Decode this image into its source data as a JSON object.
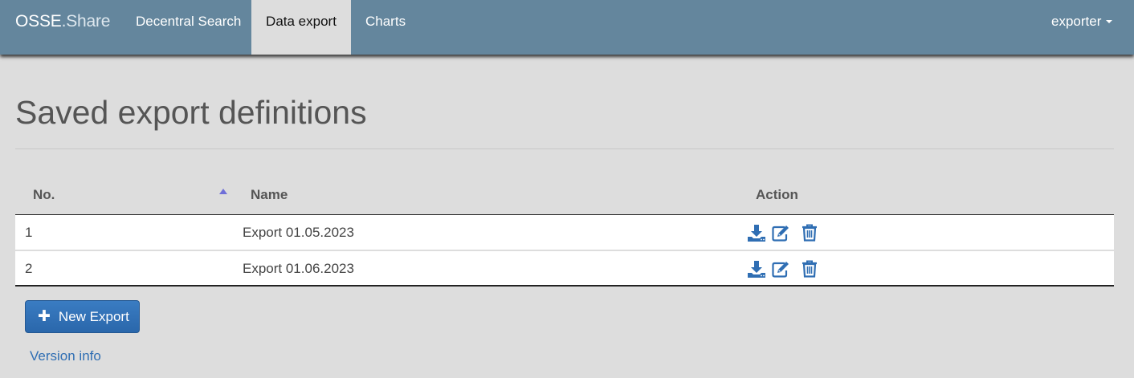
{
  "navbar": {
    "brand_part1": "OSSE",
    "brand_part2": ".Share",
    "links": {
      "search": "Decentral Search",
      "export": "Data export",
      "charts": "Charts"
    },
    "active": "Data export",
    "user": "exporter",
    "bg_color": "#64869d"
  },
  "page": {
    "title": "Saved export definitions"
  },
  "table": {
    "headers": {
      "no": "No.",
      "name": "Name",
      "action": "Action"
    },
    "sort": {
      "column": "No.",
      "direction": "ascending",
      "icon": "sort-asc-icon"
    },
    "rows": [
      {
        "no": "1",
        "name": "Export 01.05.2023",
        "actions": [
          "download-icon",
          "edit-icon",
          "delete-icon"
        ]
      },
      {
        "no": "2",
        "name": "Export 01.06.2023",
        "actions": [
          "download-icon",
          "edit-icon",
          "delete-icon"
        ]
      }
    ],
    "icon_color": "#2f6eb3"
  },
  "buttons": {
    "new_export": "New Export",
    "new_export_icon": "plus-icon"
  },
  "footer": {
    "version_link": "Version info"
  }
}
